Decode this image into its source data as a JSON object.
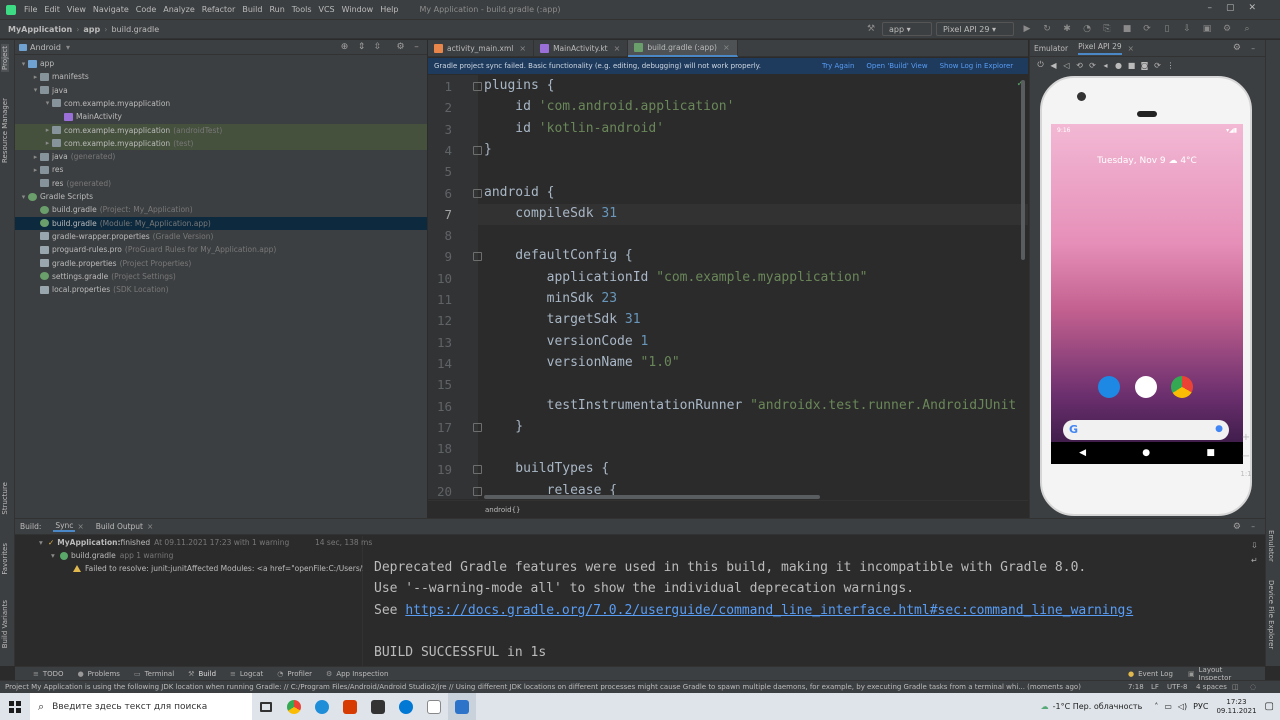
{
  "menubar": {
    "items": [
      "File",
      "Edit",
      "View",
      "Navigate",
      "Code",
      "Analyze",
      "Refactor",
      "Build",
      "Run",
      "Tools",
      "VCS",
      "Window",
      "Help"
    ],
    "window_title": "My Application - build.gradle (:app)"
  },
  "navbar": {
    "crumbs": [
      "MyApplication",
      "app",
      "build.gradle"
    ],
    "run_config": "app",
    "device": "Pixel API 29"
  },
  "left_strip": [
    "Project",
    "Resource Manager",
    "Structure",
    "Favorites",
    "Build Variants"
  ],
  "right_strip": [
    "Emulator",
    "Device File Explorer"
  ],
  "project_panel": {
    "view": "Android",
    "items": [
      {
        "label": "app",
        "extra": "",
        "depth": 0,
        "arrow": "▾",
        "icon": "folderb",
        "state": ""
      },
      {
        "label": "manifests",
        "extra": "",
        "depth": 1,
        "arrow": "▸",
        "icon": "folder",
        "state": ""
      },
      {
        "label": "java",
        "extra": "",
        "depth": 1,
        "arrow": "▾",
        "icon": "folder",
        "state": ""
      },
      {
        "label": "com.example.myapplication",
        "extra": "",
        "depth": 2,
        "arrow": "▾",
        "icon": "folder",
        "state": ""
      },
      {
        "label": "MainActivity",
        "extra": "",
        "depth": 3,
        "arrow": "",
        "icon": "kt",
        "state": ""
      },
      {
        "label": "com.example.myapplication",
        "extra": "(androidTest)",
        "depth": 2,
        "arrow": "▸",
        "icon": "folder",
        "state": "hl"
      },
      {
        "label": "com.example.myapplication",
        "extra": "(test)",
        "depth": 2,
        "arrow": "▸",
        "icon": "folder",
        "state": "hl"
      },
      {
        "label": "java",
        "extra": "(generated)",
        "depth": 1,
        "arrow": "▸",
        "icon": "folder",
        "state": ""
      },
      {
        "label": "res",
        "extra": "",
        "depth": 1,
        "arrow": "▸",
        "icon": "folder",
        "state": ""
      },
      {
        "label": "res",
        "extra": "(generated)",
        "depth": 1,
        "arrow": "",
        "icon": "folder",
        "state": ""
      },
      {
        "label": "Gradle Scripts",
        "extra": "",
        "depth": 0,
        "arrow": "▾",
        "icon": "gradle",
        "state": ""
      },
      {
        "label": "build.gradle",
        "extra": "(Project: My_Application)",
        "depth": 1,
        "arrow": "",
        "icon": "gradle",
        "state": ""
      },
      {
        "label": "build.gradle",
        "extra": "(Module: My_Application.app)",
        "depth": 1,
        "arrow": "",
        "icon": "gradle",
        "state": "sel"
      },
      {
        "label": "gradle-wrapper.properties",
        "extra": "(Gradle Version)",
        "depth": 1,
        "arrow": "",
        "icon": "file",
        "state": ""
      },
      {
        "label": "proguard-rules.pro",
        "extra": "(ProGuard Rules for My_Application.app)",
        "depth": 1,
        "arrow": "",
        "icon": "file",
        "state": ""
      },
      {
        "label": "gradle.properties",
        "extra": "(Project Properties)",
        "depth": 1,
        "arrow": "",
        "icon": "file",
        "state": ""
      },
      {
        "label": "settings.gradle",
        "extra": "(Project Settings)",
        "depth": 1,
        "arrow": "",
        "icon": "gradle",
        "state": ""
      },
      {
        "label": "local.properties",
        "extra": "(SDK Location)",
        "depth": 1,
        "arrow": "",
        "icon": "file",
        "state": ""
      }
    ]
  },
  "editor_tabs": [
    {
      "label": "activity_main.xml",
      "color": "#e8854a",
      "active": false
    },
    {
      "label": "MainActivity.kt",
      "color": "#9b6fd8",
      "active": false
    },
    {
      "label": "build.gradle (:app)",
      "color": "#6a9e6a",
      "active": true
    }
  ],
  "banner": {
    "message": "Gradle project sync failed. Basic functionality (e.g. editing, debugging) will not work properly.",
    "actions": [
      "Try Again",
      "Open 'Build' View",
      "Show Log in Explorer"
    ]
  },
  "code": {
    "current_line": 7,
    "lines": [
      [
        {
          "t": "plugins {",
          "c": ""
        }
      ],
      [
        {
          "t": "    id ",
          "c": ""
        },
        {
          "t": "'com.android.application'",
          "c": "s"
        }
      ],
      [
        {
          "t": "    id ",
          "c": ""
        },
        {
          "t": "'kotlin-android'",
          "c": "s"
        }
      ],
      [
        {
          "t": "}",
          "c": ""
        }
      ],
      [
        {
          "t": "",
          "c": ""
        }
      ],
      [
        {
          "t": "android {",
          "c": ""
        }
      ],
      [
        {
          "t": "    compileSdk ",
          "c": ""
        },
        {
          "t": "31",
          "c": "n"
        }
      ],
      [
        {
          "t": "",
          "c": ""
        }
      ],
      [
        {
          "t": "    defaultConfig {",
          "c": ""
        }
      ],
      [
        {
          "t": "        applicationId ",
          "c": ""
        },
        {
          "t": "\"com.example.myapplication\"",
          "c": "s"
        }
      ],
      [
        {
          "t": "        minSdk ",
          "c": ""
        },
        {
          "t": "23",
          "c": "n"
        }
      ],
      [
        {
          "t": "        targetSdk ",
          "c": ""
        },
        {
          "t": "31",
          "c": "n"
        }
      ],
      [
        {
          "t": "        versionCode ",
          "c": ""
        },
        {
          "t": "1",
          "c": "n"
        }
      ],
      [
        {
          "t": "        versionName ",
          "c": ""
        },
        {
          "t": "\"1.0\"",
          "c": "s"
        }
      ],
      [
        {
          "t": "",
          "c": ""
        }
      ],
      [
        {
          "t": "        testInstrumentationRunner ",
          "c": ""
        },
        {
          "t": "\"androidx.test.runner.AndroidJUnit",
          "c": "s"
        }
      ],
      [
        {
          "t": "    }",
          "c": ""
        }
      ],
      [
        {
          "t": "",
          "c": ""
        }
      ],
      [
        {
          "t": "    buildTypes {",
          "c": ""
        }
      ],
      [
        {
          "t": "        release {",
          "c": ""
        }
      ]
    ]
  },
  "editor_breadcrumb": "android{}",
  "emulator": {
    "tabs": [
      "Emulator",
      "Pixel API 29"
    ],
    "status_time": "9:16",
    "date_weather": "Tuesday, Nov 9  ☁ 4°C"
  },
  "build_panel": {
    "tabs": [
      "Build:",
      "Sync",
      "Build Output"
    ],
    "tree": [
      {
        "label": "MyApplication:",
        "rest": " finished",
        "time": "At 09.11.2021 17:23 with 1 warning",
        "right": "14 sec, 138 ms"
      },
      {
        "label": "build.gradle",
        "rest": "",
        "time": "app 1 warning",
        "right": ""
      },
      {
        "label": "Failed to resolve: junit:junit",
        "rest": "",
        "time": "Affected Modules: <a href=\"openFile:C:/Users/Sep",
        "right": ""
      }
    ],
    "output": [
      {
        "text": "Deprecated Gradle features were used in this build, making it incompatible with Gradle 8.0.",
        "link": ""
      },
      {
        "text": "Use '--warning-mode all' to show the individual deprecation warnings.",
        "link": ""
      },
      {
        "text": "See ",
        "link": "https://docs.gradle.org/7.0.2/userguide/command_line_interface.html#sec:command_line_warnings"
      },
      {
        "text": "",
        "link": ""
      },
      {
        "text": "BUILD SUCCESSFUL in 1s",
        "link": ""
      }
    ]
  },
  "tool_windows": [
    "TODO",
    "Problems",
    "Terminal",
    "Build",
    "Logcat",
    "Profiler",
    "App Inspection"
  ],
  "tool_windows_right": [
    "Event Log",
    "Layout Inspector"
  ],
  "status_line": {
    "message": "Project My Application is using the following JDK location when running Gradle: // C:/Program Files/Android/Android Studio2/jre // Using different JDK locations on different processes might cause Gradle to spawn multiple daemons, for example, by executing Gradle tasks from a terminal whi... (moments ago)",
    "position": "7:18",
    "line_sep": "LF",
    "encoding": "UTF-8",
    "indent": "4 spaces"
  },
  "taskbar": {
    "search_placeholder": "Введите здесь текст для поиска",
    "weather": "-1°C  Пер. облачность",
    "lang": "РУС",
    "time": "17:23",
    "date": "09.11.2021"
  }
}
